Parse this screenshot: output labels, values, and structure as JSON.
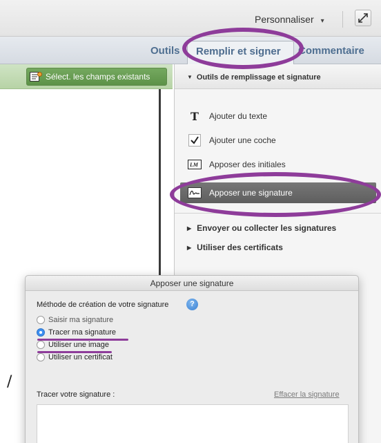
{
  "toolbar": {
    "customize_label": "Personnaliser",
    "customize_caret": "▾"
  },
  "tabs": {
    "tools": "Outils",
    "fill_sign": "Remplir et signer",
    "comment": "Commentaire"
  },
  "doc_toolbar": {
    "select_fields_label": "Sélect. les champs existants"
  },
  "right_pane": {
    "section_title": "Outils de remplissage et signature",
    "items": [
      {
        "label": "Ajouter du texte",
        "icon": "text-T-icon"
      },
      {
        "label": "Ajouter une coche",
        "icon": "checkmark-icon"
      },
      {
        "label": "Apposer des initiales",
        "icon": "initials-icon"
      },
      {
        "label": "Apposer une signature",
        "icon": "signature-icon",
        "selected": true
      }
    ],
    "subsections": [
      "Envoyer ou collecter les signatures",
      "Utiliser des certificats"
    ]
  },
  "dialog": {
    "title": "Apposer une signature",
    "method_label": "Méthode de création de votre signature",
    "help_glyph": "?",
    "options": [
      {
        "label": "Saisir ma signature",
        "selected": false
      },
      {
        "label": "Tracer ma signature",
        "selected": true
      },
      {
        "label": "Utiliser une image",
        "selected": false
      },
      {
        "label": "Utiliser un certificat",
        "selected": false
      }
    ],
    "trace_label": "Tracer votre signature :",
    "clear_link": "Effacer la signature"
  },
  "doc_text": {
    "stray_glyph": "/"
  },
  "colors": {
    "annotation": "#8e3c9a",
    "tab_text": "#4f6f91",
    "green_button": "#5d9248",
    "selected_item": "#6a6a6a",
    "radio_on": "#3d8ff0"
  }
}
